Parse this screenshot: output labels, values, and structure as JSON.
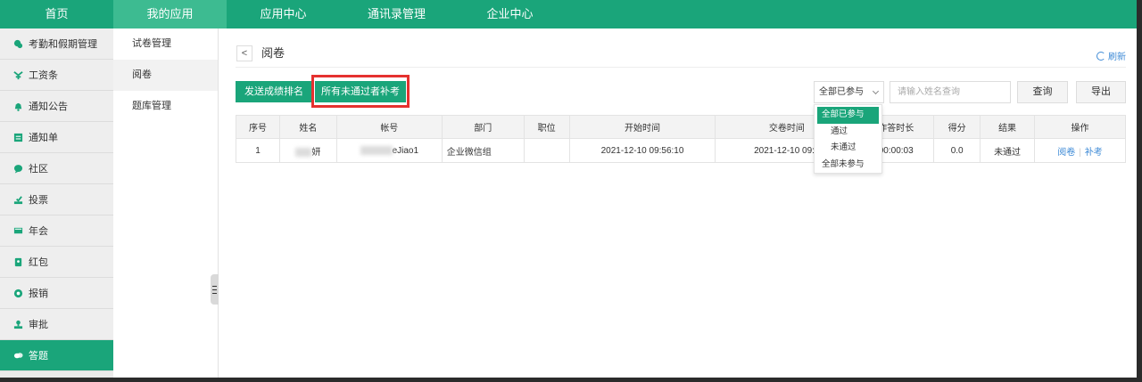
{
  "topnav": [
    {
      "label": "首页",
      "active": false
    },
    {
      "label": "我的应用",
      "active": true
    },
    {
      "label": "应用中心",
      "active": false
    },
    {
      "label": "通讯录管理",
      "active": false
    },
    {
      "label": "企业中心",
      "active": false
    }
  ],
  "sidebar": {
    "items": [
      {
        "label": "考勤和假期管理",
        "icon": "attendance-icon"
      },
      {
        "label": "工资条",
        "icon": "salary-icon"
      },
      {
        "label": "通知公告",
        "icon": "bell-icon"
      },
      {
        "label": "通知单",
        "icon": "notice-form-icon"
      },
      {
        "label": "社区",
        "icon": "community-icon"
      },
      {
        "label": "投票",
        "icon": "vote-icon"
      },
      {
        "label": "年会",
        "icon": "annual-meeting-icon"
      },
      {
        "label": "红包",
        "icon": "red-packet-icon"
      },
      {
        "label": "报销",
        "icon": "reimburse-icon"
      },
      {
        "label": "审批",
        "icon": "approval-icon"
      },
      {
        "label": "答题",
        "icon": "quiz-icon",
        "active": true
      }
    ]
  },
  "subnav": {
    "items": [
      {
        "label": "试卷管理"
      },
      {
        "label": "阅卷",
        "active": true
      },
      {
        "label": "题库管理"
      }
    ]
  },
  "main": {
    "back_label": "<",
    "title": "阅卷",
    "refresh_label": "刷新",
    "send_ranking_label": "发送成绩排名",
    "makeup_exam_label": "所有未通过者补考",
    "filter": {
      "selected": "全部已参与",
      "options": [
        "全部已参与",
        "通过",
        "未通过",
        "全部未参与"
      ]
    },
    "search": {
      "placeholder": "请输入姓名查询"
    },
    "query_label": "查询",
    "export_label": "导出"
  },
  "table": {
    "headers": [
      "序号",
      "姓名",
      "帐号",
      "部门",
      "职位",
      "开始时间",
      "交卷时间",
      "作答时长",
      "得分",
      "结果",
      "操作"
    ],
    "rows": [
      {
        "index": "1",
        "name_visible": "妍",
        "account_visible": "eJiao1",
        "department": "企业微信组",
        "position": "",
        "start_time": "2021-12-10 09:56:10",
        "submit_time": "2021-12-10 09:5",
        "duration": "00:00:03",
        "score": "0.0",
        "result": "未通过",
        "action_review": "阅卷",
        "action_makeup": "补考"
      }
    ]
  },
  "colors": {
    "brand_green": "#1aa57a",
    "highlight_red": "#e5312f",
    "link_blue": "#3d8ad6"
  }
}
